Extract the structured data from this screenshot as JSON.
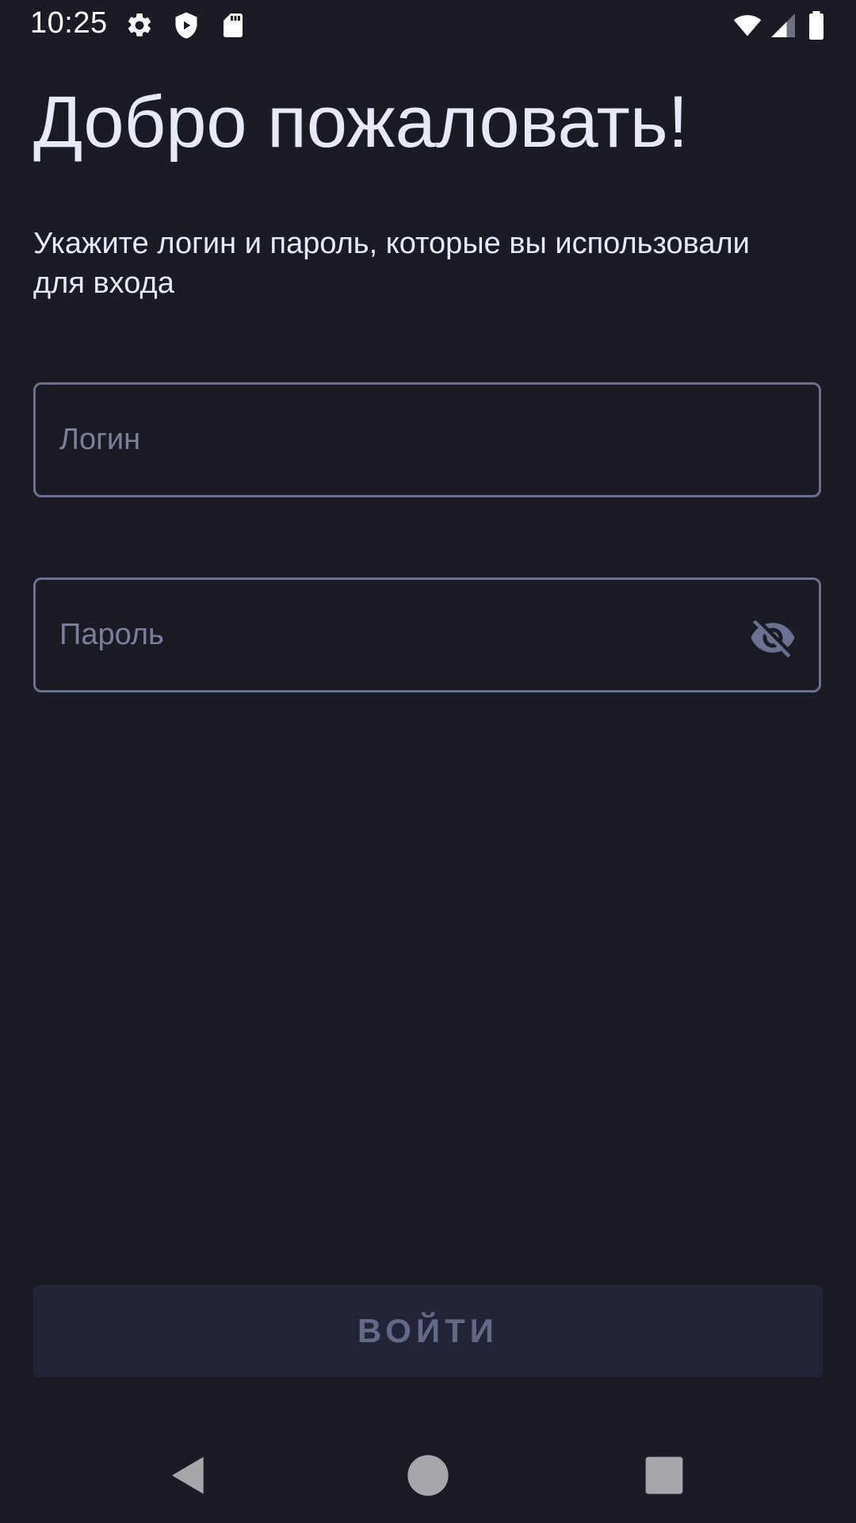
{
  "status_bar": {
    "time": "10:25",
    "icons": [
      "settings-icon",
      "shield-play-icon",
      "sd-card-icon",
      "wifi-icon",
      "signal-icon",
      "battery-icon"
    ]
  },
  "login_screen": {
    "title": "Добро пожаловать!",
    "subtitle": "Укажите логин и пароль, которые вы использовали для входа",
    "login_field": {
      "placeholder": "Логин",
      "value": ""
    },
    "password_field": {
      "placeholder": "Пароль",
      "value": "",
      "toggle_icon": "eye-off-icon"
    },
    "submit_label": "ВОЙТИ"
  },
  "nav_bar": {
    "icons": [
      "back-icon",
      "home-icon",
      "recents-icon"
    ]
  },
  "colors": {
    "background": "#1b1b26",
    "text": "#e6e9f7",
    "field_border": "#6c7191",
    "placeholder": "#7a7f9c",
    "button_bg": "#222538",
    "button_text": "#646985"
  }
}
